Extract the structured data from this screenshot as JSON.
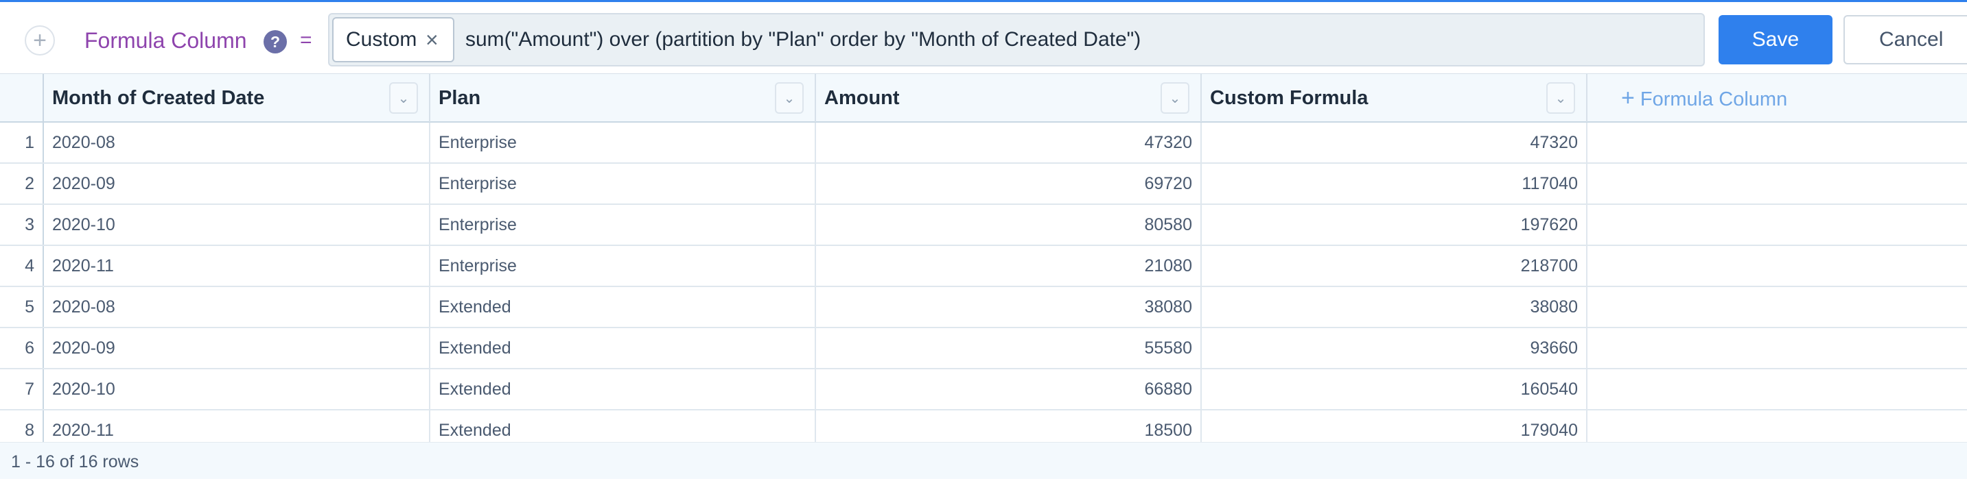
{
  "formula_bar": {
    "add_icon": "plus-circle-icon",
    "label": "Formula Column",
    "help_icon": "question-circle-icon",
    "help_glyph": "?",
    "equals": "=",
    "chip_label": "Custom",
    "chip_close_glyph": "×",
    "formula": "sum(\"Amount\") over (partition by \"Plan\" order by \"Month of Created Date\")",
    "save_label": "Save",
    "cancel_label": "Cancel"
  },
  "table": {
    "columns": [
      {
        "label": "Month of Created Date"
      },
      {
        "label": "Plan"
      },
      {
        "label": "Amount"
      },
      {
        "label": "Custom Formula"
      }
    ],
    "dropdown_glyph": "⌄",
    "add_column_plus": "+",
    "add_column_label": "Formula Column",
    "rows": [
      {
        "n": "1",
        "month": "2020-08",
        "plan": "Enterprise",
        "amount": "47320",
        "custom": "47320"
      },
      {
        "n": "2",
        "month": "2020-09",
        "plan": "Enterprise",
        "amount": "69720",
        "custom": "117040"
      },
      {
        "n": "3",
        "month": "2020-10",
        "plan": "Enterprise",
        "amount": "80580",
        "custom": "197620"
      },
      {
        "n": "4",
        "month": "2020-11",
        "plan": "Enterprise",
        "amount": "21080",
        "custom": "218700"
      },
      {
        "n": "5",
        "month": "2020-08",
        "plan": "Extended",
        "amount": "38080",
        "custom": "38080"
      },
      {
        "n": "6",
        "month": "2020-09",
        "plan": "Extended",
        "amount": "55580",
        "custom": "93660"
      },
      {
        "n": "7",
        "month": "2020-10",
        "plan": "Extended",
        "amount": "66880",
        "custom": "160540"
      },
      {
        "n": "8",
        "month": "2020-11",
        "plan": "Extended",
        "amount": "18500",
        "custom": "179040"
      }
    ]
  },
  "footer": {
    "row_count": "1 - 16 of 16 rows"
  },
  "colors": {
    "accent": "#2f80ed",
    "formula_label": "#8e44ad",
    "add_column_link": "#6fa6e6"
  }
}
